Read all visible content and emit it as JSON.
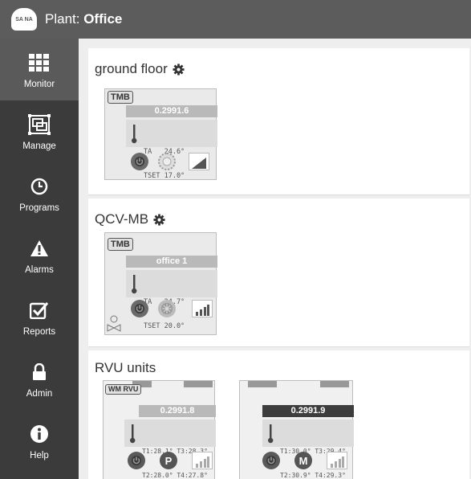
{
  "header": {
    "logo_text": "SA NA",
    "plant_label": "Plant: ",
    "plant_name": "Office"
  },
  "sidebar": {
    "items": [
      {
        "label": "Monitor",
        "icon": "grid-icon",
        "active": true
      },
      {
        "label": "Manage",
        "icon": "manage-icon",
        "active": false
      },
      {
        "label": "Programs",
        "icon": "clock-icon",
        "active": false
      },
      {
        "label": "Alarms",
        "icon": "warning-icon",
        "active": false
      },
      {
        "label": "Reports",
        "icon": "checkbox-icon",
        "active": false
      },
      {
        "label": "Admin",
        "icon": "lock-icon",
        "active": false
      },
      {
        "label": "Help",
        "icon": "info-icon",
        "active": false
      }
    ]
  },
  "groups": [
    {
      "title": "ground floor",
      "devices": [
        {
          "badge": "TMB",
          "name": "0.2991.6",
          "line1": "TA   24.6°",
          "line2": "TSET 17.0°"
        }
      ]
    },
    {
      "title": "QCV-MB",
      "devices": [
        {
          "badge": "TMB",
          "name": "office 1",
          "line1": "TA   24.7°",
          "line2": "TSET 20.0°"
        }
      ]
    },
    {
      "title": "RVU units",
      "devices": [
        {
          "badge": "WM RVU",
          "name": "0.2991.8",
          "line1": "T1:28.1° T3:28.3°",
          "line2": "T2:28.0° T4:27.8°",
          "mode": "P"
        },
        {
          "badge": "",
          "name": "0.2991.9",
          "line1": "T1:30.0° T3:29.4°",
          "line2": "T2:30.9° T4:29.3°",
          "mode": "M"
        }
      ]
    }
  ]
}
